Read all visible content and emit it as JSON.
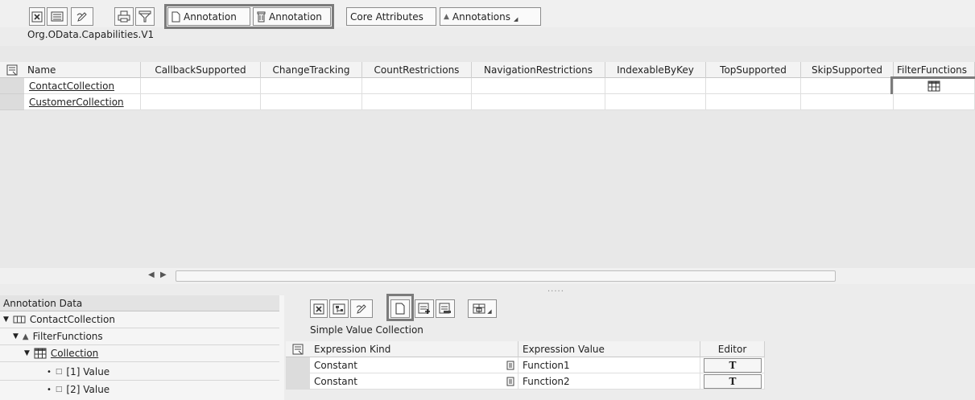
{
  "toolbar": {
    "create_annotation_label": "Annotation",
    "delete_annotation_label": "Annotation",
    "core_attributes_label": "Core Attributes",
    "annotations_menu_label": "Annotations"
  },
  "vocabulary": {
    "title": "Org.OData.Capabilities.V1"
  },
  "main_grid": {
    "columns": [
      "Name",
      "CallbackSupported",
      "ChangeTracking",
      "CountRestrictions",
      "NavigationRestrictions",
      "IndexableByKey",
      "TopSupported",
      "SkipSupported",
      "FilterFunctions"
    ],
    "rows": [
      {
        "name": "ContactCollection"
      },
      {
        "name": "CustomerCollection"
      }
    ]
  },
  "annotation_data": {
    "title": "Annotation Data",
    "tree": [
      {
        "label": "ContactCollection",
        "level": 0
      },
      {
        "label": "FilterFunctions",
        "level": 1
      },
      {
        "label": "Collection",
        "level": 2
      },
      {
        "label": "[1] Value",
        "level": 3
      },
      {
        "label": "[2] Value",
        "level": 3
      }
    ]
  },
  "detail": {
    "title": "Simple Value Collection",
    "columns": [
      "Expression Kind",
      "Expression Value",
      "Editor"
    ],
    "rows": [
      {
        "kind": "Constant",
        "value": "Function1",
        "editor": "T"
      },
      {
        "kind": "Constant",
        "value": "Function2",
        "editor": "T"
      }
    ]
  },
  "colors": {
    "highlight_border": "#7b7b7b",
    "background": "#ececec"
  }
}
